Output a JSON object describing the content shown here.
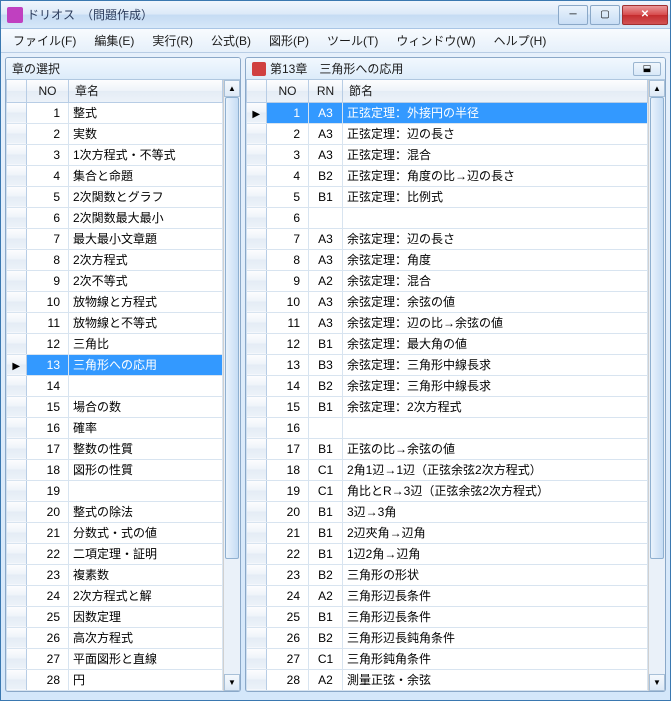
{
  "window": {
    "title": "ドリオス　（問題作成）"
  },
  "win_buttons": {
    "min": "─",
    "max": "▢",
    "close": "✕"
  },
  "menubar": [
    "ファイル(F)",
    "編集(E)",
    "実行(R)",
    "公式(B)",
    "図形(P)",
    "ツール(T)",
    "ウィンドウ(W)",
    "ヘルプ(H)"
  ],
  "left_panel": {
    "title": "章の選択",
    "cols": {
      "no": "NO",
      "name": "章名"
    },
    "selected_index": 12,
    "rows": [
      {
        "no": "1",
        "name": "整式"
      },
      {
        "no": "2",
        "name": "実数"
      },
      {
        "no": "3",
        "name": "1次方程式・不等式"
      },
      {
        "no": "4",
        "name": "集合と命題"
      },
      {
        "no": "5",
        "name": "2次関数とグラフ"
      },
      {
        "no": "6",
        "name": "2次関数最大最小"
      },
      {
        "no": "7",
        "name": "最大最小文章題"
      },
      {
        "no": "8",
        "name": "2次方程式"
      },
      {
        "no": "9",
        "name": "2次不等式"
      },
      {
        "no": "10",
        "name": "放物線と方程式"
      },
      {
        "no": "11",
        "name": "放物線と不等式"
      },
      {
        "no": "12",
        "name": "三角比"
      },
      {
        "no": "13",
        "name": "三角形への応用"
      },
      {
        "no": "14",
        "name": ""
      },
      {
        "no": "15",
        "name": "場合の数"
      },
      {
        "no": "16",
        "name": "確率"
      },
      {
        "no": "17",
        "name": "整数の性質"
      },
      {
        "no": "18",
        "name": "図形の性質"
      },
      {
        "no": "19",
        "name": ""
      },
      {
        "no": "20",
        "name": "整式の除法"
      },
      {
        "no": "21",
        "name": "分数式・式の値"
      },
      {
        "no": "22",
        "name": "二項定理・証明"
      },
      {
        "no": "23",
        "name": "複素数"
      },
      {
        "no": "24",
        "name": "2次方程式と解"
      },
      {
        "no": "25",
        "name": "因数定理"
      },
      {
        "no": "26",
        "name": "高次方程式"
      },
      {
        "no": "27",
        "name": "平面図形と直線"
      },
      {
        "no": "28",
        "name": "円"
      }
    ]
  },
  "right_panel": {
    "title": "第13章　三角形への応用",
    "close": "⬓",
    "cols": {
      "no": "NO",
      "rn": "RN",
      "name": "節名"
    },
    "selected_index": 0,
    "rows": [
      {
        "no": "1",
        "rn": "A3",
        "name": "正弦定理：外接円の半径"
      },
      {
        "no": "2",
        "rn": "A3",
        "name": "正弦定理：辺の長さ"
      },
      {
        "no": "3",
        "rn": "A3",
        "name": "正弦定理：混合"
      },
      {
        "no": "4",
        "rn": "B2",
        "name": "正弦定理：角度の比→辺の長さ"
      },
      {
        "no": "5",
        "rn": "B1",
        "name": "正弦定理：比例式"
      },
      {
        "no": "6",
        "rn": "",
        "name": ""
      },
      {
        "no": "7",
        "rn": "A3",
        "name": "余弦定理：辺の長さ"
      },
      {
        "no": "8",
        "rn": "A3",
        "name": "余弦定理：角度"
      },
      {
        "no": "9",
        "rn": "A2",
        "name": "余弦定理：混合"
      },
      {
        "no": "10",
        "rn": "A3",
        "name": "余弦定理：余弦の値"
      },
      {
        "no": "11",
        "rn": "A3",
        "name": "余弦定理：辺の比→余弦の値"
      },
      {
        "no": "12",
        "rn": "B1",
        "name": "余弦定理：最大角の値"
      },
      {
        "no": "13",
        "rn": "B3",
        "name": "余弦定理：三角形中線長求"
      },
      {
        "no": "14",
        "rn": "B2",
        "name": "余弦定理：三角形中線長求"
      },
      {
        "no": "15",
        "rn": "B1",
        "name": "余弦定理：2次方程式"
      },
      {
        "no": "16",
        "rn": "",
        "name": ""
      },
      {
        "no": "17",
        "rn": "B1",
        "name": "正弦の比→余弦の値"
      },
      {
        "no": "18",
        "rn": "C1",
        "name": "2角1辺→1辺（正弦余弦2次方程式）"
      },
      {
        "no": "19",
        "rn": "C1",
        "name": "角比とR→3辺（正弦余弦2次方程式）"
      },
      {
        "no": "20",
        "rn": "B1",
        "name": "3辺→3角"
      },
      {
        "no": "21",
        "rn": "B1",
        "name": "2辺夾角→辺角"
      },
      {
        "no": "22",
        "rn": "B1",
        "name": "1辺2角→辺角"
      },
      {
        "no": "23",
        "rn": "B2",
        "name": "三角形の形状"
      },
      {
        "no": "24",
        "rn": "A2",
        "name": "三角形辺長条件"
      },
      {
        "no": "25",
        "rn": "B1",
        "name": "三角形辺長条件"
      },
      {
        "no": "26",
        "rn": "B2",
        "name": "三角形辺長鈍角条件"
      },
      {
        "no": "27",
        "rn": "C1",
        "name": "三角形鈍角条件"
      },
      {
        "no": "28",
        "rn": "A2",
        "name": "測量正弦・余弦"
      }
    ]
  },
  "scrollbar": {
    "up": "▲",
    "down": "▼"
  }
}
